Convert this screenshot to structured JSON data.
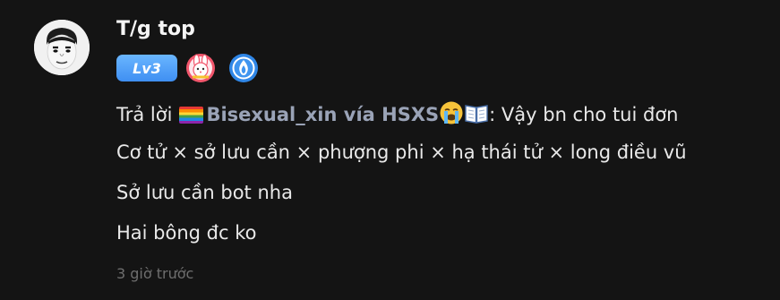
{
  "comment": {
    "username": "T/g top",
    "level_badge": "Lv3",
    "badges": [
      "bunny-badge-icon",
      "blue-flame-badge-icon"
    ],
    "reply": {
      "prefix": "Trả lời",
      "mention": "Bisexual_xin vía HSXS",
      "separator": ": ",
      "quoted_text": "Vậy bn cho tui đơn"
    },
    "lines": [
      "Cơ tử × sở lưu cần × phượng phi × hạ thái tử × long điều vũ",
      "Sở lưu cần bot nha",
      "Hai bông đc ko"
    ],
    "timestamp": "3 giờ trước"
  },
  "colors": {
    "background": "#141414",
    "text": "#e9e9e9",
    "mention": "#9aa3b7",
    "level_badge": "#4f9ef5",
    "timestamp": "#6e6e6e"
  }
}
